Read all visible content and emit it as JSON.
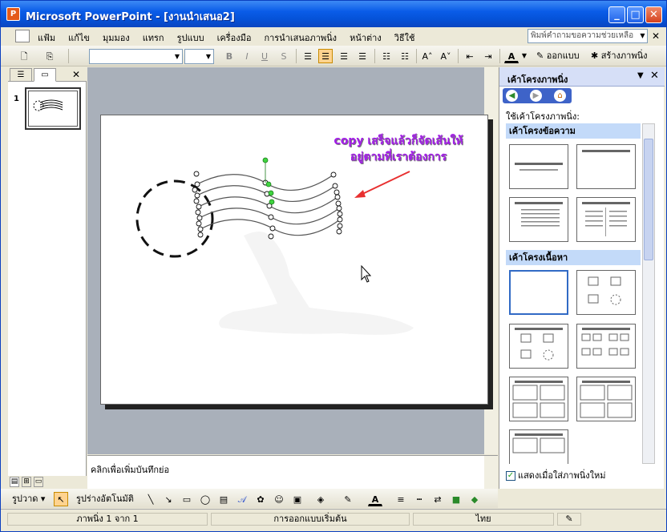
{
  "window": {
    "title": "Microsoft PowerPoint - [งานนำเสนอ2]",
    "app_icon": "powerpoint-icon",
    "buttons": {
      "minimize": "_",
      "maximize": "□",
      "close": "✕"
    }
  },
  "menubar": {
    "items": [
      "แฟ้ม",
      "แก้ไข",
      "มุมมอง",
      "แทรก",
      "รูปแบบ",
      "เครื่องมือ",
      "การนำเสนอภาพนิ่ง",
      "หน้าต่าง",
      "วิธีใช้"
    ],
    "help_placeholder": "พิมพ์คำถามขอความช่วยเหลือ"
  },
  "toolbar": {
    "font_name": "",
    "font_size": "",
    "bold": "B",
    "italic": "I",
    "underline": "U",
    "shadow": "S",
    "design_label": "ออกแบบ",
    "new_slide_label": "สร้างภาพนิ่ง"
  },
  "left_pane": {
    "slide_number": "1",
    "close": "✕"
  },
  "slide": {
    "annotation_line1": "copy เสร็จแล้วก็จัดเส้นให้",
    "annotation_line2": "อยู่ตามที่เราต้องการ",
    "annotation_color": "#a31ee8",
    "arrow_color": "#e83030"
  },
  "notes": {
    "placeholder": "คลิกเพื่อเพิ่มบันทึกย่อ"
  },
  "task_pane": {
    "title": "เค้าโครงภาพนิ่ง",
    "subtitle": "ใช้เค้าโครงภาพนิ่ง:",
    "section_text_layouts": "เค้าโครงข้อความ",
    "section_content_layouts": "เค้าโครงเนื้อหา",
    "footer_checkbox_label": "แสดงเมื่อใส่ภาพนิ่งใหม่",
    "footer_checked": true
  },
  "drawing_toolbar": {
    "draw_label": "รูปวาด",
    "autoshapes_label": "รูปร่างอัตโนมัติ"
  },
  "statusbar": {
    "slide_info": "ภาพนิ่ง 1 จาก 1",
    "design": "การออกแบบเริ่มต้น",
    "language": "ไทย"
  }
}
